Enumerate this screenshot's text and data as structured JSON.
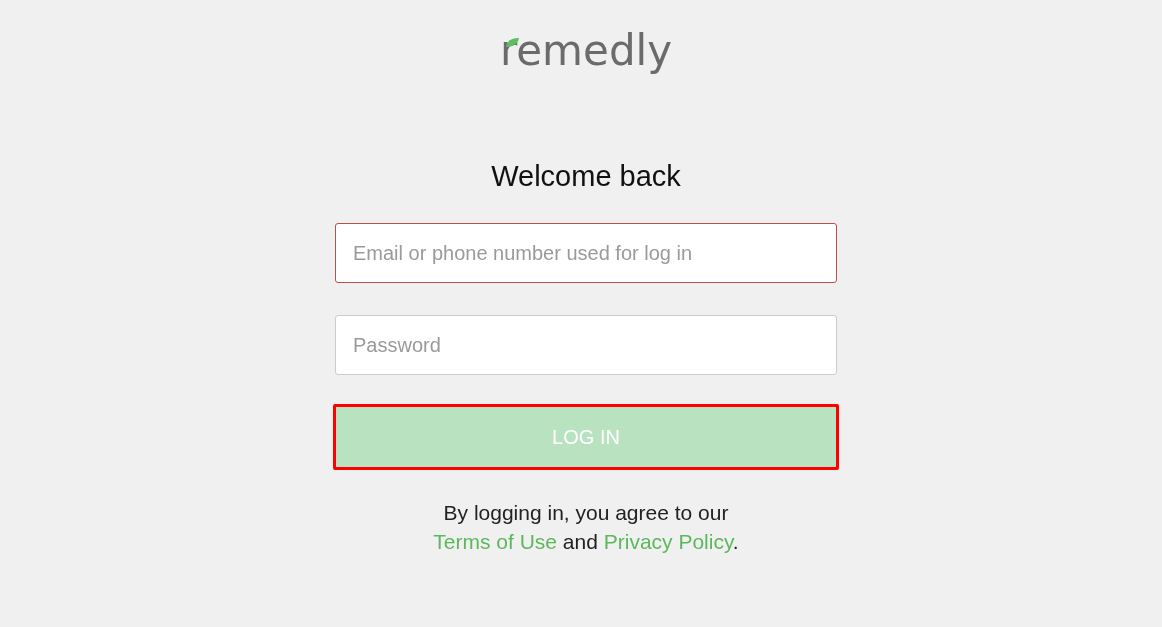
{
  "logo": {
    "text": "remedly"
  },
  "heading": "Welcome back",
  "email_field": {
    "placeholder": "Email or phone number used for log in",
    "invalid": true
  },
  "password_field": {
    "placeholder": "Password",
    "invalid": false
  },
  "login_button": {
    "label": "LOG IN",
    "disabled": true,
    "highlighted": true
  },
  "agreement": [
    {
      "kind": "text",
      "text": "By logging in, you agree to our "
    },
    {
      "kind": "link",
      "text": "Terms of Use"
    },
    {
      "kind": "text",
      "text": " and "
    },
    {
      "kind": "link",
      "text": "Privacy Policy"
    },
    {
      "kind": "text",
      "text": "."
    }
  ]
}
